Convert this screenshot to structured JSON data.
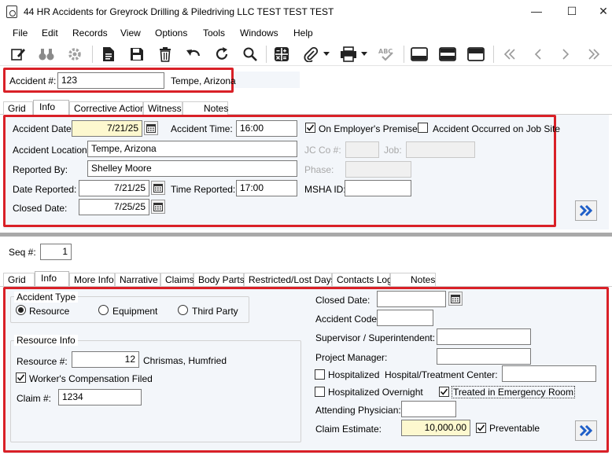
{
  "window": {
    "title": "44 HR Accidents for Greyrock Drilling & Piledriving LLC TEST TEST TEST",
    "minimize": "—",
    "maximize": "☐",
    "close": "✕"
  },
  "menu": [
    "File",
    "Edit",
    "Records",
    "View",
    "Options",
    "Tools",
    "Windows",
    "Help"
  ],
  "header": {
    "accident_label": "Accident #:",
    "accident_value": "123",
    "location_text": "Tempe, Arizona"
  },
  "top_tabs": [
    "Grid",
    "Info",
    "Corrective Action",
    "Witness",
    "Notes"
  ],
  "info": {
    "accident_date_label": "Accident Date:",
    "accident_date": "7/21/25",
    "accident_time_label": "Accident Time:",
    "accident_time": "16:00",
    "on_premises_label": "On Employer's Premises",
    "on_job_site_label": "Accident Occurred on Job Site",
    "location_label": "Accident Location:",
    "location": "Tempe, Arizona",
    "jc_co_label": "JC Co #:",
    "job_label": "Job:",
    "reported_by_label": "Reported By:",
    "reported_by": "Shelley Moore",
    "phase_label": "Phase:",
    "date_reported_label": "Date Reported:",
    "date_reported": "7/21/25",
    "time_reported_label": "Time Reported:",
    "time_reported": "17:00",
    "msha_label": "MSHA ID:",
    "closed_date_label": "Closed Date:",
    "closed_date": "7/25/25"
  },
  "seq": {
    "label": "Seq #:",
    "value": "1"
  },
  "bottom_tabs": [
    "Grid",
    "Info",
    "More Info",
    "Narrative",
    "Claims",
    "Body Parts",
    "Restricted/Lost Days",
    "Contacts Log",
    "Notes"
  ],
  "detail": {
    "accident_type_title": "Accident Type",
    "type_resource": "Resource",
    "type_equipment": "Equipment",
    "type_third_party": "Third Party",
    "resource_info_title": "Resource Info",
    "resource_label": "Resource #:",
    "resource_value": "12",
    "resource_name": "Chrismas, Humfried",
    "workers_comp_label": "Worker's Compensation Filed",
    "claim_label": "Claim #:",
    "claim_value": "1234",
    "closed_date_label": "Closed Date:",
    "accident_code_label": "Accident Code:",
    "supervisor_label": "Supervisor / Superintendent:",
    "project_manager_label": "Project Manager:",
    "hospitalized_label": "Hospitalized",
    "hospital_center_label": "Hospital/Treatment Center:",
    "hospitalized_overnight_label": "Hospitalized Overnight",
    "treated_er_label": "Treated in Emergency Room",
    "attending_physician_label": "Attending Physician:",
    "claim_estimate_label": "Claim Estimate:",
    "claim_estimate": "10,000.00",
    "preventable_label": "Preventable"
  },
  "colors": {
    "highlight_red": "#d92027",
    "required_yellow": "#fdf8cf",
    "nav_blue": "#1f5fc8"
  }
}
